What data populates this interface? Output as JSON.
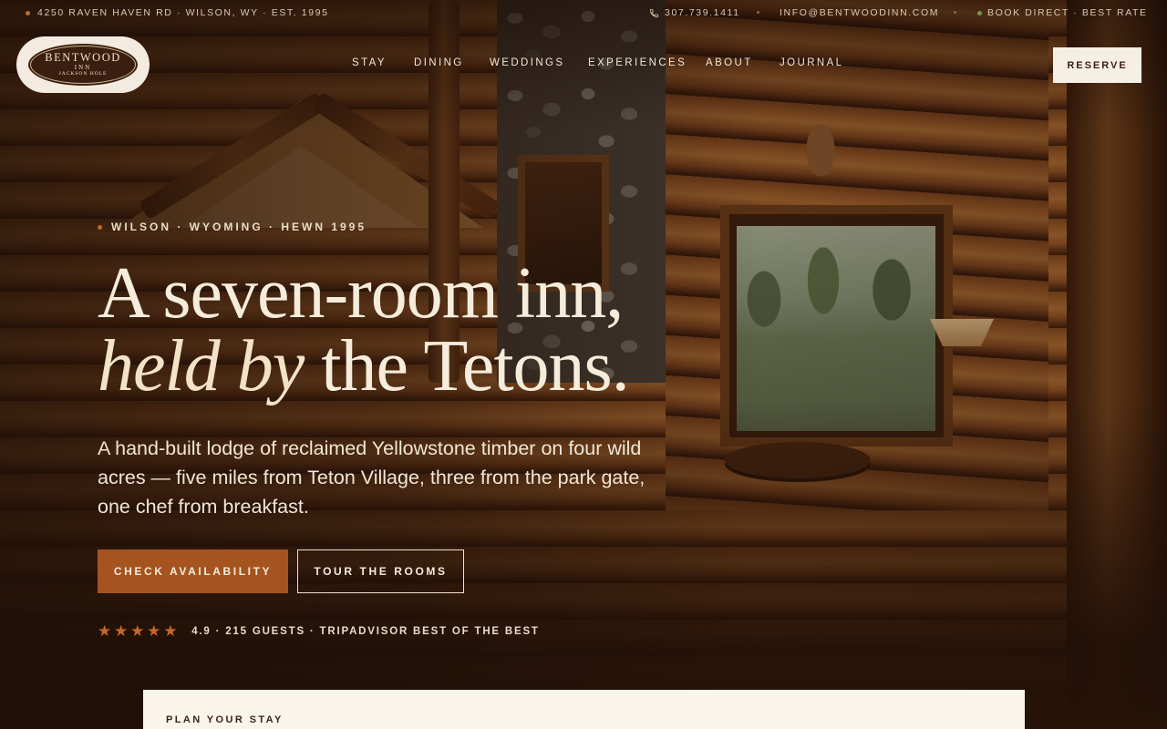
{
  "topbar": {
    "address": "4250 RAVEN HAVEN RD · WILSON, WY · EST. 1995",
    "phone": "307.739.1411",
    "phone_icon": "phone-icon",
    "email": "INFO@BENTWOODINN.COM",
    "book_direct": "BOOK DIRECT · BEST RATE"
  },
  "logo": {
    "name": "BENTWOOD",
    "inn": "INN",
    "location": "JACKSON HOLE"
  },
  "nav": {
    "items": [
      "STAY",
      "DINING",
      "WEDDINGS",
      "EXPERIENCES",
      "ABOUT",
      "JOURNAL"
    ],
    "reserve_label": "RESERVE"
  },
  "hero": {
    "eyebrow": "WILSON · WYOMING · HEWN 1995",
    "headline_line1": "A seven-room inn,",
    "headline_italic": "held by",
    "headline_line2_rest": " the Tetons.",
    "subcopy": "A hand-built lodge of reclaimed Yellowstone timber on four wild acres — five miles from Teton Village, three from the park gate, one chef from breakfast.",
    "primary_cta": "CHECK AVAILABILITY",
    "secondary_cta": "TOUR THE ROOMS",
    "rating": {
      "stars": 5,
      "text": "4.9 · 215 GUESTS · TRIPADVISOR BEST OF THE BEST"
    }
  },
  "plan": {
    "title": "PLAN YOUR STAY"
  },
  "colors": {
    "accent": "#a5541f",
    "star": "#c4682a",
    "cream": "#f6efe3",
    "dark_brown": "#3a1f10"
  }
}
